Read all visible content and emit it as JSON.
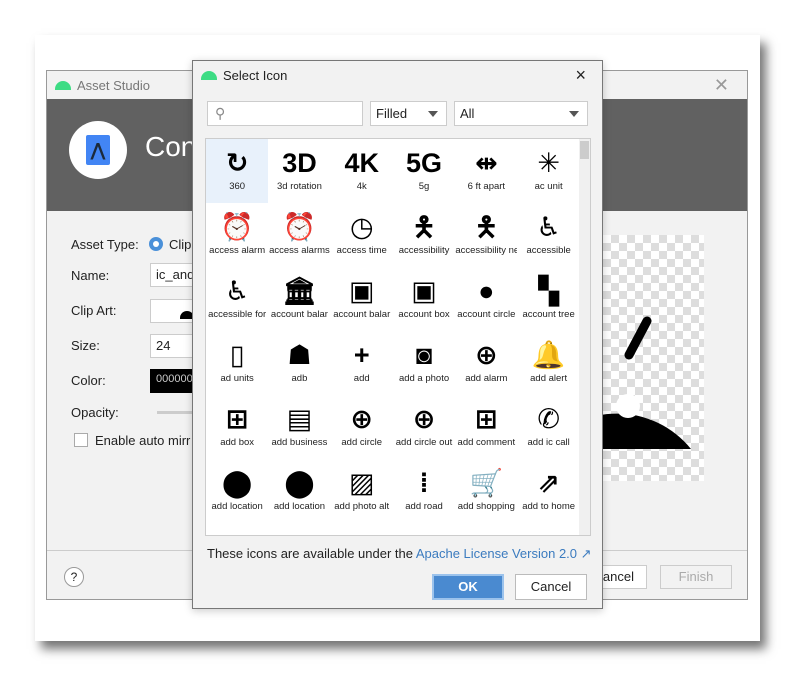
{
  "background_dialog": {
    "title": "Asset Studio",
    "header_title": "Con",
    "labels": {
      "asset_type": "Asset Type:",
      "name": "Name:",
      "clip_art": "Clip Art:",
      "size": "Size:",
      "color": "Color:",
      "opacity": "Opacity:"
    },
    "asset_type_value": "Clip",
    "name_value": "ic_and",
    "size_value": "24",
    "color_value": "000000",
    "enable_auto_mirror": "Enable auto mirr",
    "help": "?",
    "cancel": "ancel",
    "finish": "Finish"
  },
  "select_icon": {
    "title": "Select Icon",
    "close": "×",
    "search_placeholder": "",
    "style": "Filled",
    "category": "All",
    "icons": [
      {
        "name": "360",
        "glyph": "↻"
      },
      {
        "name": "3d rotation",
        "glyph": "3D"
      },
      {
        "name": "4k",
        "glyph": "4K"
      },
      {
        "name": "5g",
        "glyph": "5G"
      },
      {
        "name": "6 ft apart",
        "glyph": "⇹"
      },
      {
        "name": "ac unit",
        "glyph": "✳"
      },
      {
        "name": "access alarm",
        "glyph": "⏰"
      },
      {
        "name": "access alarms",
        "glyph": "⏰"
      },
      {
        "name": "access time",
        "glyph": "◷"
      },
      {
        "name": "accessibility",
        "glyph": "🯅"
      },
      {
        "name": "accessibility ne",
        "glyph": "🯅"
      },
      {
        "name": "accessible",
        "glyph": "♿"
      },
      {
        "name": "accessible for",
        "glyph": "♿"
      },
      {
        "name": "account balar",
        "glyph": "🏛"
      },
      {
        "name": "account balar",
        "glyph": "▣"
      },
      {
        "name": "account box",
        "glyph": "▣"
      },
      {
        "name": "account circle",
        "glyph": "●"
      },
      {
        "name": "account tree",
        "glyph": "▚"
      },
      {
        "name": "ad units",
        "glyph": "▯"
      },
      {
        "name": "adb",
        "glyph": "☗"
      },
      {
        "name": "add",
        "glyph": "+"
      },
      {
        "name": "add a photo",
        "glyph": "◙"
      },
      {
        "name": "add alarm",
        "glyph": "⊕"
      },
      {
        "name": "add alert",
        "glyph": "🔔"
      },
      {
        "name": "add box",
        "glyph": "⊞"
      },
      {
        "name": "add business",
        "glyph": "▤"
      },
      {
        "name": "add circle",
        "glyph": "⊕"
      },
      {
        "name": "add circle out",
        "glyph": "⊕"
      },
      {
        "name": "add comment",
        "glyph": "⊞"
      },
      {
        "name": "add ic call",
        "glyph": "✆"
      },
      {
        "name": "add location",
        "glyph": "⬤"
      },
      {
        "name": "add location",
        "glyph": "⬤"
      },
      {
        "name": "add photo alt",
        "glyph": "▨"
      },
      {
        "name": "add road",
        "glyph": "⁞"
      },
      {
        "name": "add shopping",
        "glyph": "🛒"
      },
      {
        "name": "add to home",
        "glyph": "⇗"
      },
      {
        "name": "",
        "glyph": "▮"
      },
      {
        "name": "",
        "glyph": "▭"
      },
      {
        "name": "",
        "glyph": "▭"
      },
      {
        "name": "",
        "glyph": "◯"
      },
      {
        "name": "",
        "glyph": "▲"
      },
      {
        "name": "",
        "glyph": "↗"
      }
    ],
    "selected_index": 0,
    "license_text": "These icons are available under the ",
    "license_link": "Apache License Version 2.0 ↗",
    "ok": "OK",
    "cancel": "Cancel"
  }
}
